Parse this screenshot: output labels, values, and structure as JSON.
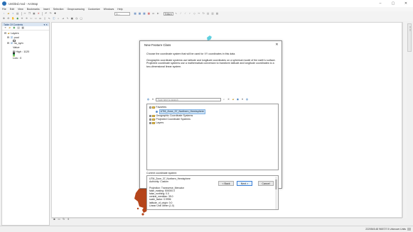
{
  "window": {
    "title": "Untitled.mxd - ArcMap",
    "controls": {
      "minimize": "–",
      "maximize": "▢",
      "close": "✕"
    }
  },
  "menubar": [
    "File",
    "Edit",
    "View",
    "Bookmarks",
    "Insert",
    "Selection",
    "Geoprocessing",
    "Customize",
    "Windows",
    "Help"
  ],
  "toolbar": {
    "scale": "1:...",
    "editor_label": "Editor▾"
  },
  "toc": {
    "header": "Table Of Contents",
    "header_controls": "▾ ✕",
    "layers_label": "Layers",
    "items": [
      {
        "name": "pool",
        "level": 1
      },
      {
        "name": "",
        "level": 2
      },
      {
        "name": "hs_sym",
        "level": 1
      },
      {
        "name": "Value",
        "level": 2
      },
      {
        "name": "High : 1120",
        "level": 2
      },
      {
        "name": "",
        "level": 2
      },
      {
        "name": "Low : 0",
        "level": 2
      }
    ]
  },
  "map": {
    "background": "#ffffff",
    "raster_color": "#b5451b"
  },
  "status": {
    "coordinates": "2220545.48 965727.5 Unknown Units"
  },
  "dialog": {
    "title": "New Feature Class",
    "close": "✕",
    "instruction": "Choose the coordinate system that will be used for XY coordinates in this data.",
    "description": "Geographic coordinate systems use latitude and longitude coordinates on a spherical model of the earth's surface. Projected coordinate systems use a mathematical conversion to transform latitude and longitude coordinates to a two-dimensional linear system.",
    "search_placeholder": "Type here to search",
    "tree": [
      {
        "label": "Favorites",
        "type": "folder",
        "expanded": true,
        "level": 0
      },
      {
        "label": "UTM_Zone_37_Northern_Hemisphere",
        "type": "crs",
        "selected": true,
        "level": 1
      },
      {
        "label": "Geographic Coordinate Systems",
        "type": "folder",
        "level": 0
      },
      {
        "label": "Projected Coordinate Systems",
        "type": "folder",
        "level": 0
      },
      {
        "label": "Layers",
        "type": "folder",
        "level": 0
      }
    ],
    "current_label": "Current coordinate system:",
    "current_lines": [
      "UTM_Zone_37_Northern_Hemisphere",
      "Authority: Custom",
      "",
      "Projection: Transverse_Mercator",
      "false_easting: 500000.0",
      "false_northing: 0.0",
      "central_meridian: 39.0",
      "scale_factor: 0.9996",
      "latitude_of_origin: 0.0",
      "Linear Unit: Meter (1.0)"
    ],
    "buttons": {
      "back": "< Back",
      "next": "Next >",
      "cancel": "Cancel"
    }
  }
}
